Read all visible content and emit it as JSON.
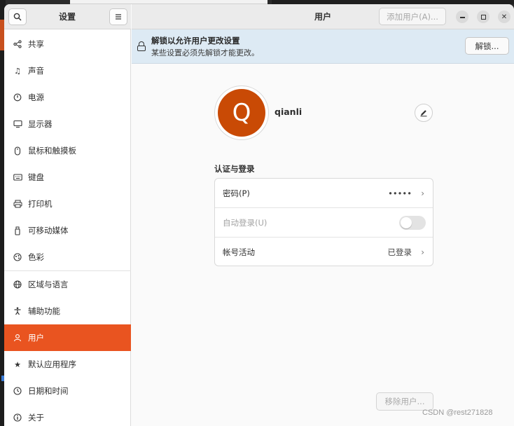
{
  "sidebar": {
    "title": "设置",
    "items": [
      {
        "label": "共享",
        "icon": "share-icon"
      },
      {
        "label": "声音",
        "icon": "music-note-icon"
      },
      {
        "label": "电源",
        "icon": "power-icon"
      },
      {
        "label": "显示器",
        "icon": "display-icon"
      },
      {
        "label": "鼠标和触摸板",
        "icon": "mouse-icon"
      },
      {
        "label": "键盘",
        "icon": "keyboard-icon"
      },
      {
        "label": "打印机",
        "icon": "printer-icon"
      },
      {
        "label": "可移动媒体",
        "icon": "removable-media-icon"
      },
      {
        "label": "色彩",
        "icon": "color-icon"
      },
      {
        "label": "区域与语言",
        "icon": "globe-icon"
      },
      {
        "label": "辅助功能",
        "icon": "accessibility-icon"
      },
      {
        "label": "用户",
        "icon": "user-icon",
        "active": true
      },
      {
        "label": "默认应用程序",
        "icon": "star-icon"
      },
      {
        "label": "日期和时间",
        "icon": "clock-icon"
      },
      {
        "label": "关于",
        "icon": "info-icon"
      }
    ]
  },
  "header": {
    "title": "用户",
    "add_user_label": "添加用户(A)..."
  },
  "banner": {
    "title": "解锁以允许用户更改设置",
    "subtitle": "某些设置必须先解锁才能更改。",
    "unlock_label": "解锁..."
  },
  "user": {
    "avatar_letter": "Q",
    "name": "qianli"
  },
  "auth": {
    "section_title": "认证与登录",
    "password_label": "密码(P)",
    "password_value": "•••••",
    "autologin_label": "自动登录(U)",
    "autologin_enabled": false,
    "activity_label": "帐号活动",
    "activity_value": "已登录"
  },
  "remove_user_label": "移除用户...",
  "watermark": "CSDN @rest271828",
  "colors": {
    "accent": "#e95420",
    "avatar": "#c94a05",
    "banner": "#ddeaf4"
  }
}
